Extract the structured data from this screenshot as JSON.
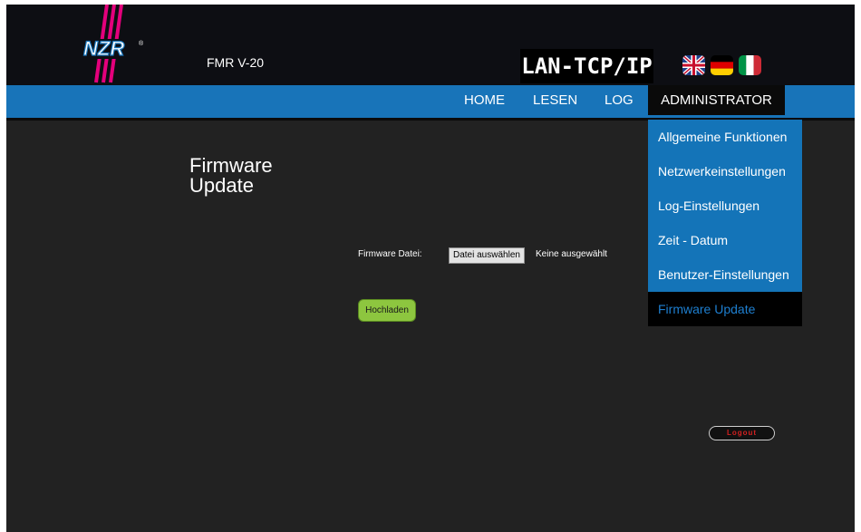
{
  "header": {
    "logo_text": "NZR",
    "device_name": "FMR V-20",
    "lan_label": "LAN-TCP/IP",
    "flags": [
      "uk-flag-icon",
      "german-flag-icon",
      "italian-flag-icon"
    ]
  },
  "nav": {
    "items": [
      "HOME",
      "LESEN",
      "LOG"
    ],
    "admin": "ADMINISTRATOR"
  },
  "admin_menu": {
    "items": [
      "Allgemeine Funktionen",
      "Netzwerkeinstellungen",
      "Log-Einstellungen",
      "Zeit - Datum",
      "Benutzer-Einstellungen",
      "Firmware Update"
    ],
    "active_index": 5
  },
  "page": {
    "title": "Firmware Update",
    "file_label": "Firmware Datei:",
    "choose_button": "Datei auswählen",
    "no_file": "Keine ausgewählt",
    "upload_button": "Hochladen",
    "logout_button": "Logout"
  },
  "colors": {
    "nav_blue": "#1874b9",
    "background": "#222222",
    "upload_green": "#8dc63f",
    "logout_red": "#d32020",
    "logo_pink": "#e4007c"
  }
}
